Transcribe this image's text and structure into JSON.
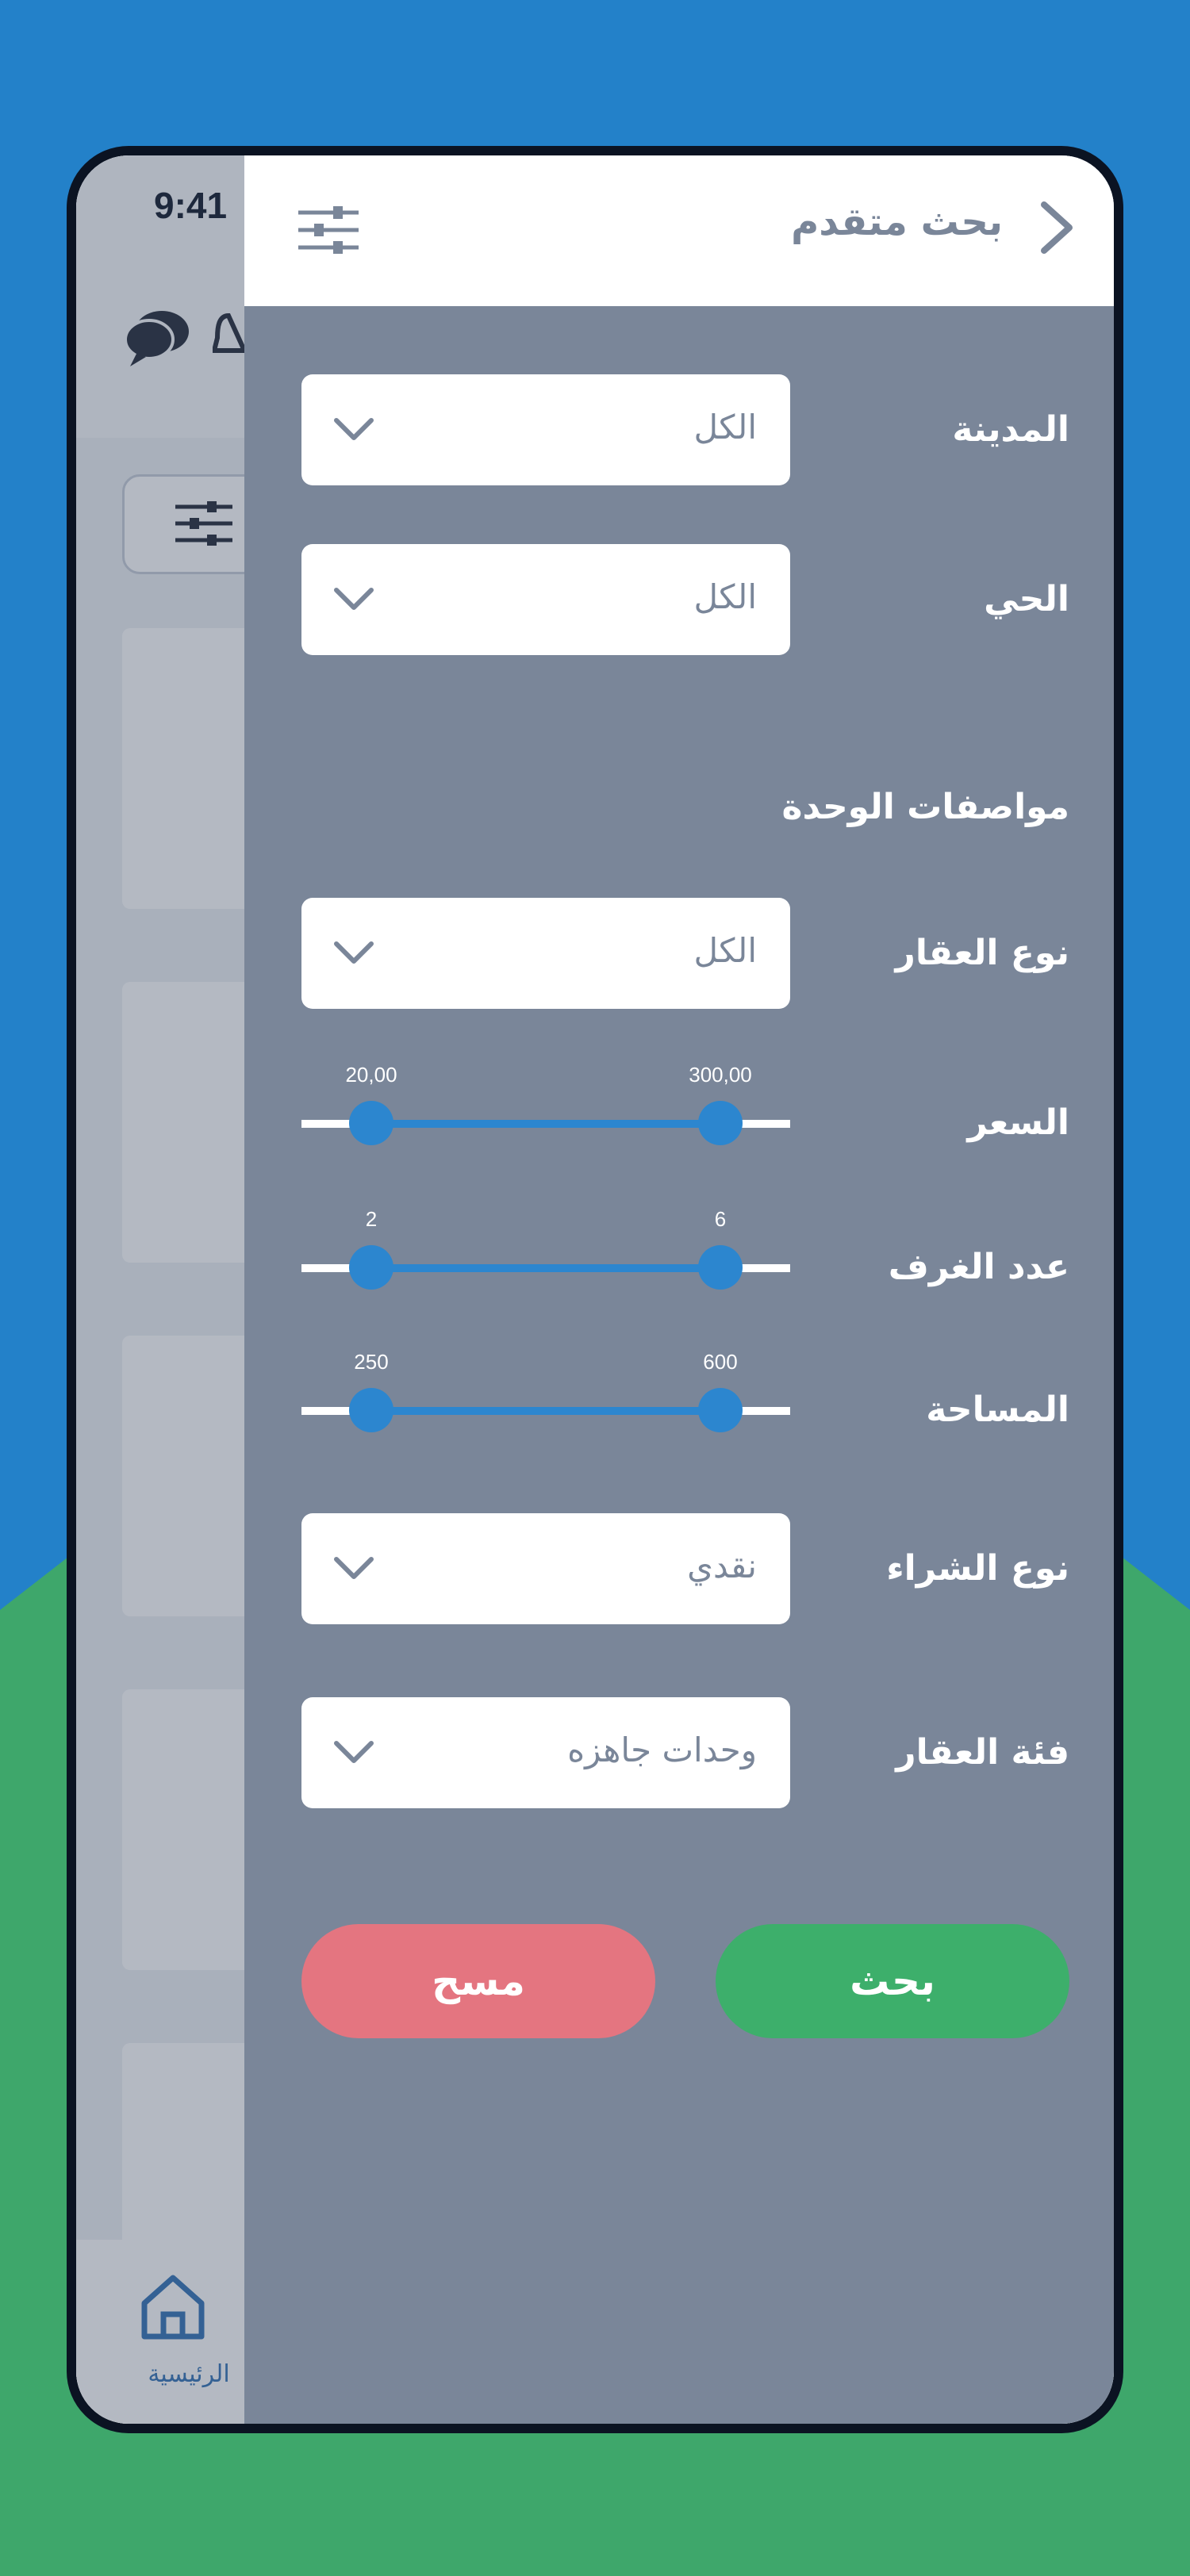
{
  "status_bar": {
    "time": "9:41"
  },
  "bottom_nav": {
    "home_label": "الرئيسية"
  },
  "drawer": {
    "title": "بحث متقدم",
    "fields": {
      "city": {
        "label": "المدينة",
        "value": "الكل"
      },
      "district": {
        "label": "الحي",
        "value": "الكل"
      },
      "section_title": "مواصفات الوحدة",
      "property_type": {
        "label": "نوع العقار",
        "value": "الكل"
      },
      "price": {
        "label": "السعر",
        "min": "20,00",
        "max": "300,00"
      },
      "rooms": {
        "label": "عدد الغرف",
        "min": "2",
        "max": "6"
      },
      "area": {
        "label": "المساحة",
        "min": "250",
        "max": "600"
      },
      "purchase_type": {
        "label": "نوع الشراء",
        "value": "نقدي"
      },
      "property_category": {
        "label": "فئة العقار",
        "value": "وحدات جاهزه"
      }
    },
    "buttons": {
      "search": "بحث",
      "clear": "مسح"
    }
  },
  "colors": {
    "background_blue": "#2381c9",
    "background_green": "#3ea76b",
    "drawer_bg": "#7a8699",
    "slider_accent": "#2c86cf",
    "search_button": "#3daf6b",
    "clear_button": "#e47580"
  }
}
